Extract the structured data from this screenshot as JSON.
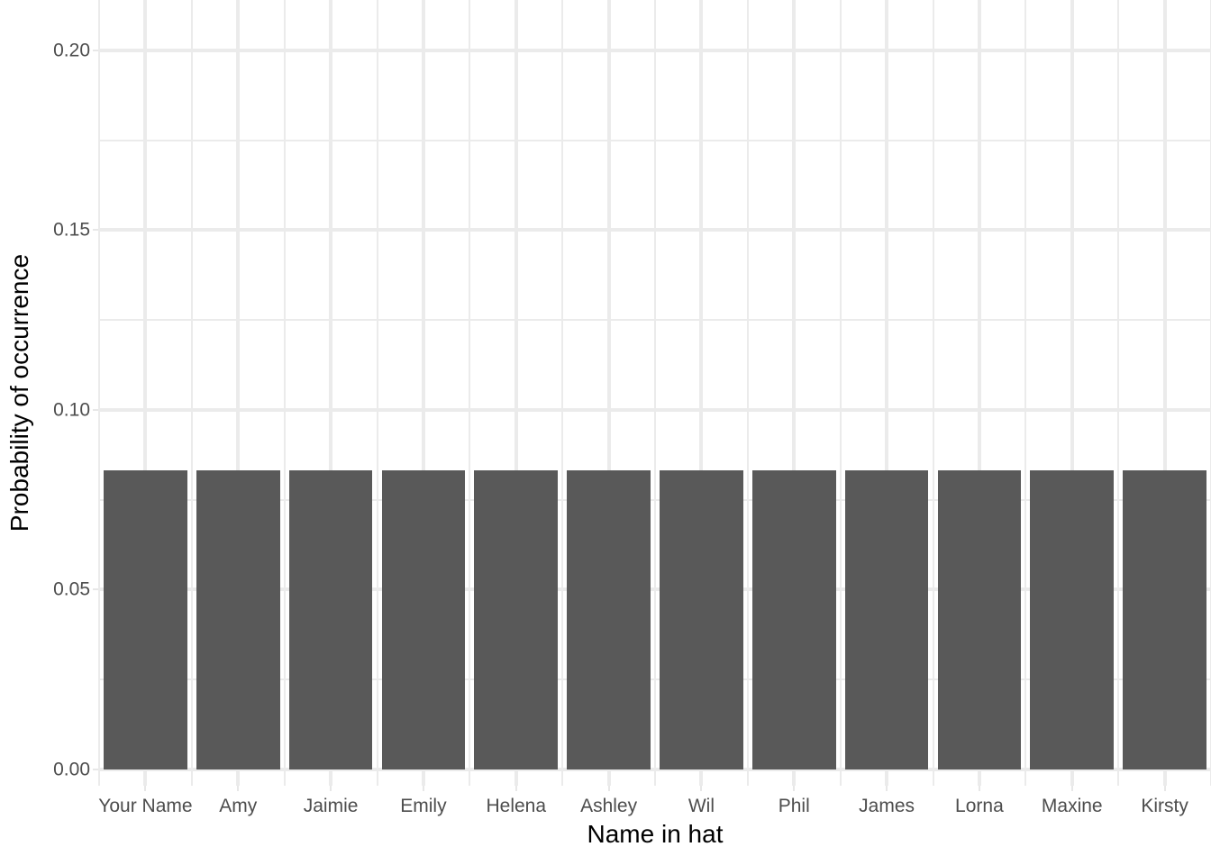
{
  "chart_data": {
    "type": "bar",
    "title": "",
    "subtitle": "",
    "xlabel": "Name in hat",
    "ylabel": "Probability of occurrence",
    "categories": [
      "Your Name",
      "Amy",
      "Jaimie",
      "Emily",
      "Helena",
      "Ashley",
      "Wil",
      "Phil",
      "James",
      "Lorna",
      "Maxine",
      "Kirsty"
    ],
    "values": [
      0.0833,
      0.0833,
      0.0833,
      0.0833,
      0.0833,
      0.0833,
      0.0833,
      0.0833,
      0.0833,
      0.0833,
      0.0833,
      0.0833
    ],
    "ylim": [
      -0.0045,
      0.214
    ],
    "y_ticks": [
      0.0,
      0.05,
      0.1,
      0.15,
      0.2
    ],
    "y_tick_labels": [
      "0.00",
      "0.05",
      "0.10",
      "0.15",
      "0.20"
    ],
    "y_minor_ticks": [
      0.025,
      0.075,
      0.125,
      0.175
    ],
    "grid": true,
    "legend": "none",
    "bar_color": "#595959",
    "grid_color": "#ebebeb",
    "panel_background": "#ffffff",
    "tick_label_color": "#4d4d4d",
    "axis_title_color": "#000000",
    "annotations": []
  }
}
